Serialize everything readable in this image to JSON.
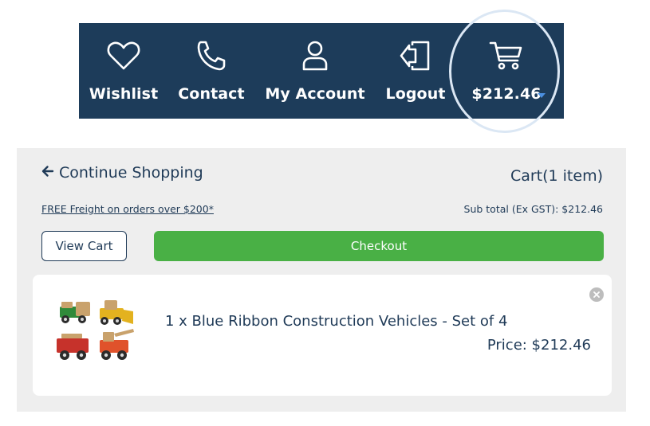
{
  "nav": {
    "wishlist": {
      "label": "Wishlist",
      "icon": "heart-icon"
    },
    "contact": {
      "label": "Contact",
      "icon": "phone-icon"
    },
    "account": {
      "label": "My Account",
      "icon": "user-icon"
    },
    "logout": {
      "label": "Logout",
      "icon": "logout-icon"
    },
    "cart": {
      "label": "$212.46",
      "icon": "cart-icon"
    }
  },
  "cart": {
    "continue_label": "Continue Shopping",
    "count_label": "Cart(1 item)",
    "freight_label": "FREE Freight on orders over $200*",
    "subtotal_label": "Sub total (Ex GST): $212.46",
    "view_cart_label": "View Cart",
    "checkout_label": "Checkout",
    "items": [
      {
        "name": "1 x Blue Ribbon Construction Vehicles - Set of 4",
        "price": "Price: $212.46"
      }
    ]
  },
  "colors": {
    "nav_bg": "#1d3c5a",
    "text": "#1f3a57",
    "checkout_green": "#49b045",
    "panel_bg": "#eeeeee",
    "cart_caret": "#4a8fe0"
  }
}
